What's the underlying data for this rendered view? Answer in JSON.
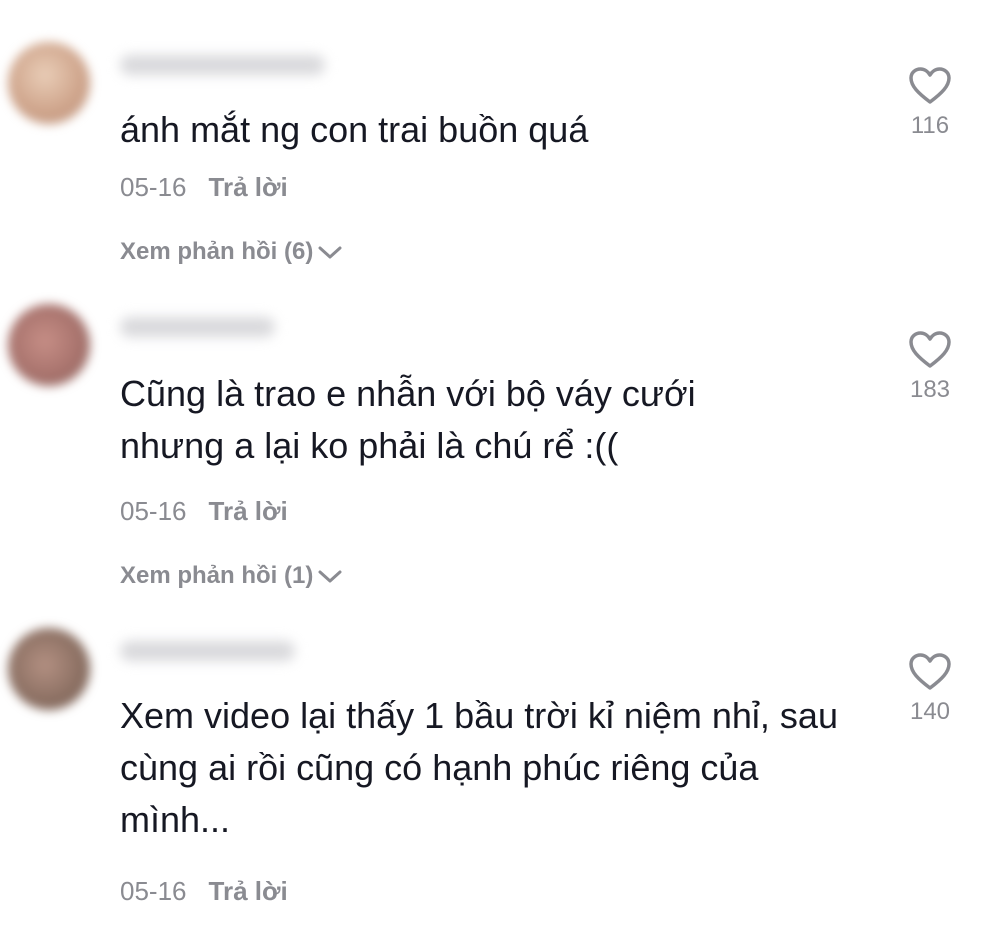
{
  "comments": [
    {
      "avatar_color": "#cfa58c",
      "text": "ánh mắt ng con trai buồn quá",
      "date": "05-16",
      "reply_label": "Trả lời",
      "view_replies": "Xem phản hồi (6)",
      "likes": "116"
    },
    {
      "avatar_color": "#a8736d",
      "text": "Cũng là trao e nhẫn với bộ váy cưới nhưng a lại ko phải là chú rể :((",
      "date": "05-16",
      "reply_label": "Trả lời",
      "view_replies": "Xem phản hồi (1)",
      "likes": "183"
    },
    {
      "avatar_color": "#8d7164",
      "text": "Xem video lại thấy 1 bầu trời kỉ niệm nhỉ, sau cùng ai rồi cũng có hạnh phúc riêng của mình...",
      "date": "05-16",
      "reply_label": "Trả lời",
      "likes": "140"
    }
  ],
  "icons": {
    "like": "heart-outline-icon",
    "expand": "chevron-down-icon"
  },
  "colors": {
    "text": "#161823",
    "muted": "#8a8b91",
    "background": "#ffffff"
  }
}
